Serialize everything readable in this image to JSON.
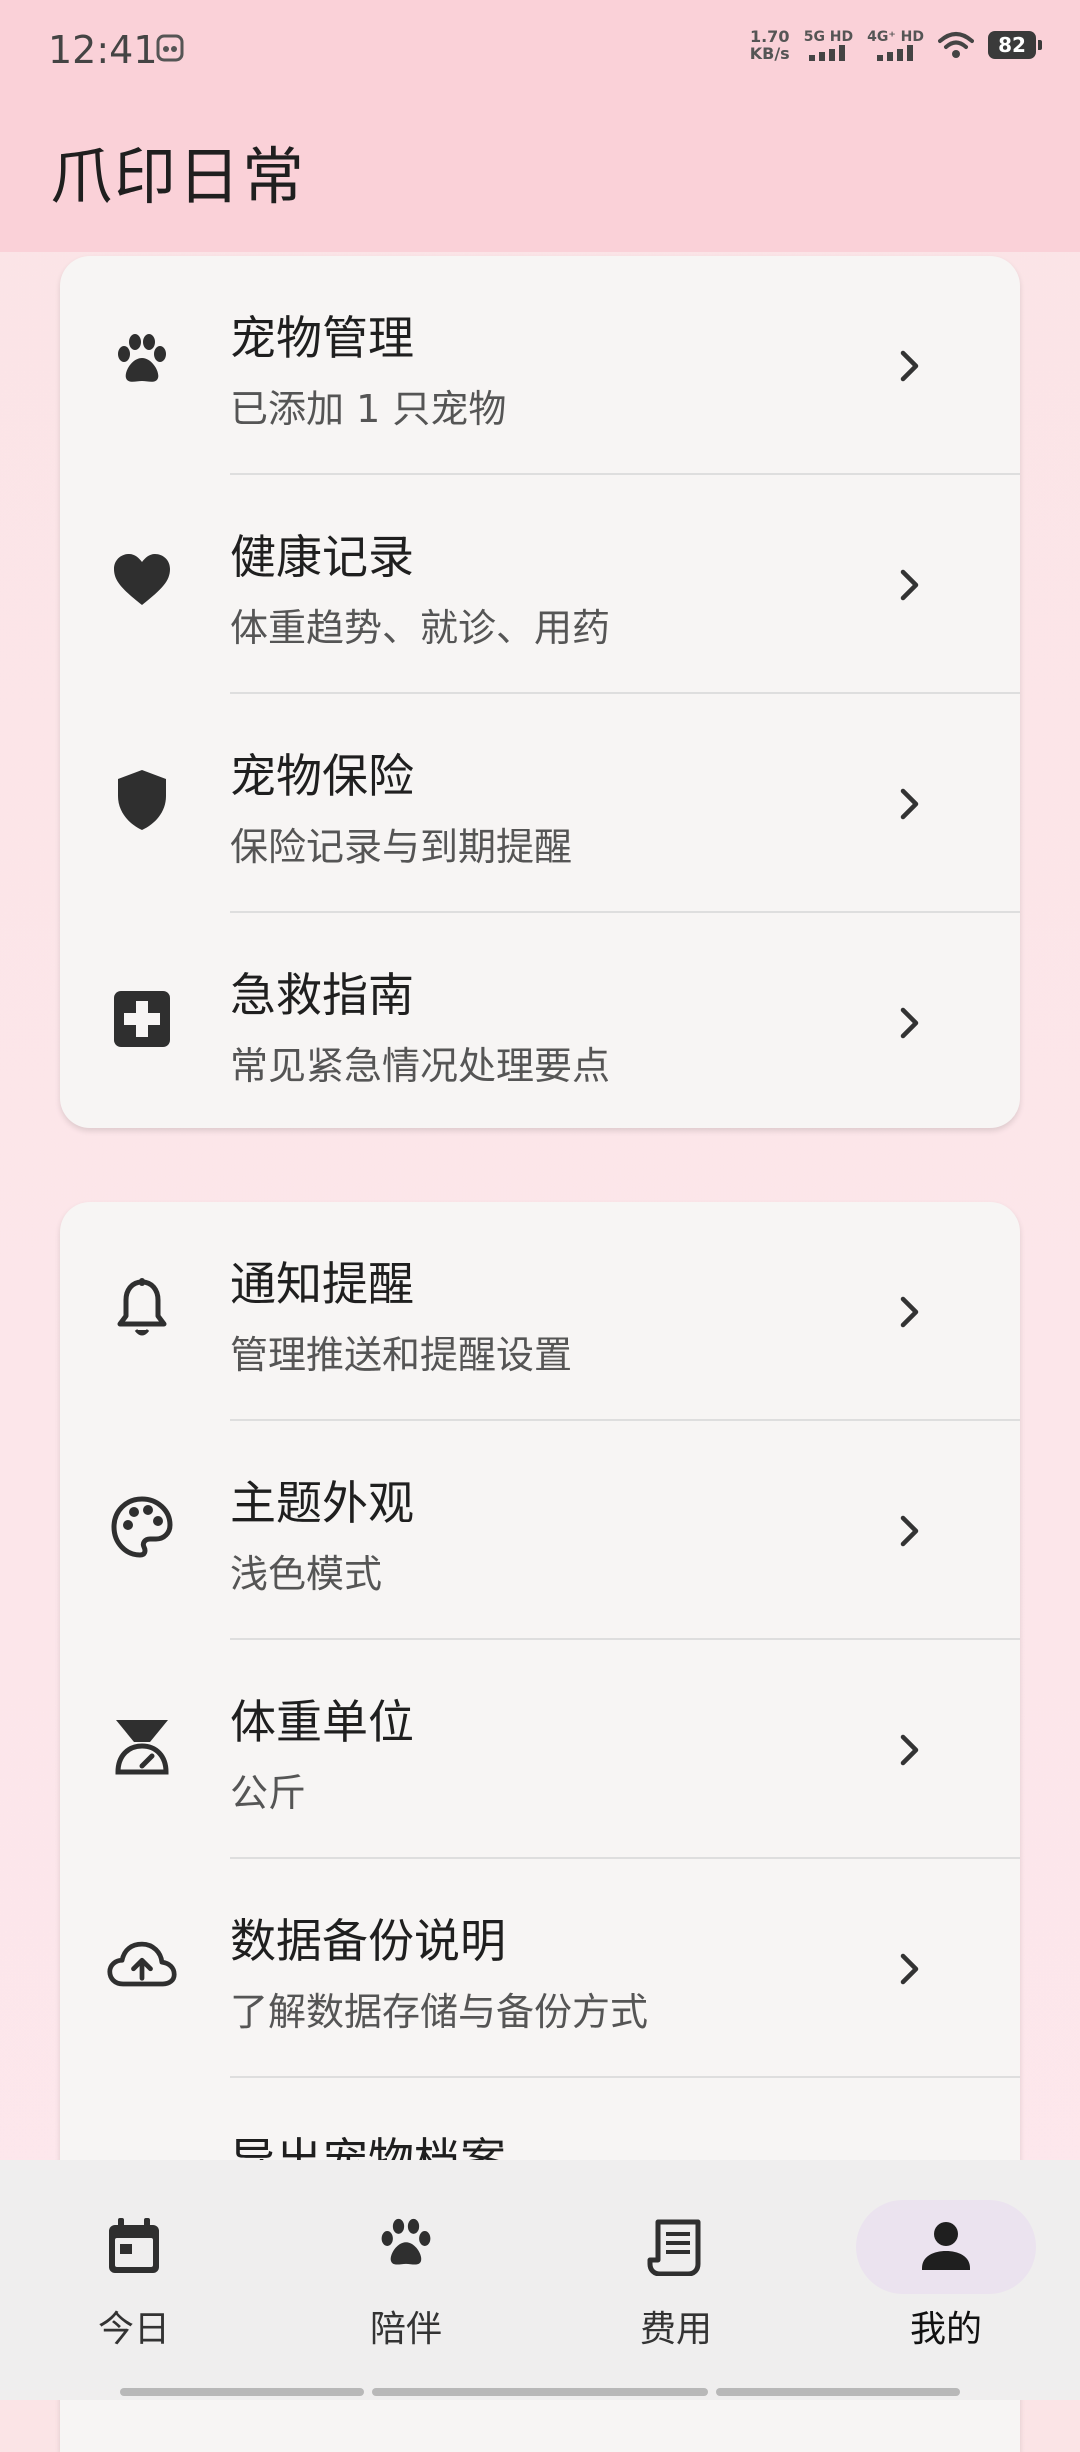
{
  "status": {
    "time": "12:41",
    "net_speed_value": "1.70",
    "net_speed_unit": "KB/s",
    "sim1_label": "5G HD",
    "sim2_label": "4G⁺ HD",
    "battery": "82"
  },
  "app": {
    "title": "爪印日常"
  },
  "section1": {
    "items": [
      {
        "title": "宠物管理",
        "subtitle": "已添加 1 只宠物",
        "icon": "paw-icon"
      },
      {
        "title": "健康记录",
        "subtitle": "体重趋势、就诊、用药",
        "icon": "heart-icon"
      },
      {
        "title": "宠物保险",
        "subtitle": "保险记录与到期提醒",
        "icon": "shield-icon"
      },
      {
        "title": "急救指南",
        "subtitle": "常见紧急情况处理要点",
        "icon": "first-aid-icon"
      }
    ]
  },
  "section2": {
    "items": [
      {
        "title": "通知提醒",
        "subtitle": "管理推送和提醒设置",
        "icon": "bell-icon"
      },
      {
        "title": "主题外观",
        "subtitle": "浅色模式",
        "icon": "palette-icon"
      },
      {
        "title": "体重单位",
        "subtitle": "公斤",
        "icon": "scale-icon"
      },
      {
        "title": "数据备份说明",
        "subtitle": "了解数据存储与备份方式",
        "icon": "cloud-upload-icon"
      },
      {
        "title": "导出宠物档案",
        "subtitle": "",
        "icon": "export-icon"
      }
    ]
  },
  "nav": {
    "items": [
      {
        "label": "今日",
        "icon": "calendar-icon"
      },
      {
        "label": "陪伴",
        "icon": "paw-icon"
      },
      {
        "label": "费用",
        "icon": "receipt-icon"
      },
      {
        "label": "我的",
        "icon": "person-icon",
        "selected": true
      }
    ]
  },
  "colors": {
    "appbar": "#fad1d8",
    "card": "#f7f5f4",
    "icon": "#2f2f2f",
    "nav_selected_pill": "#ebe3ef"
  }
}
